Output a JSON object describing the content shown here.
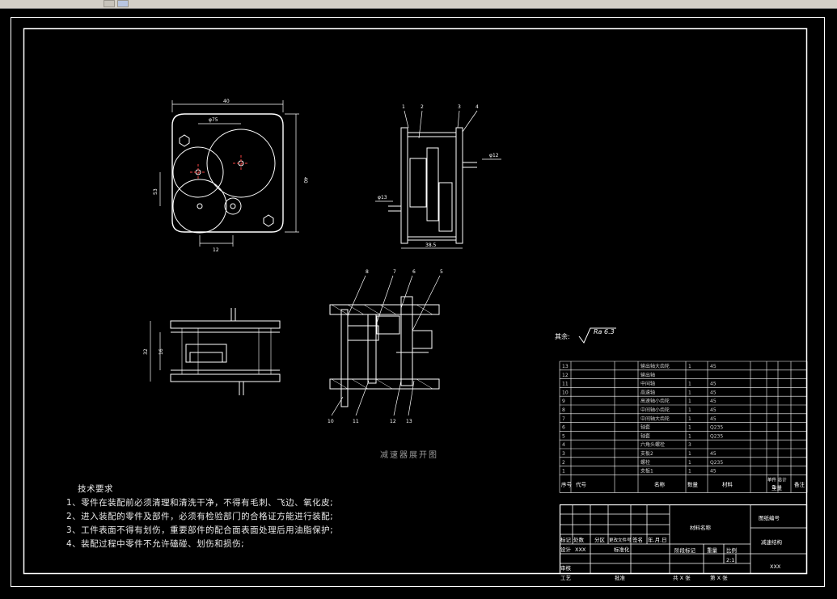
{
  "drawing": {
    "title_caption": "减速器展开图",
    "surface_finish": {
      "prefix": "其余:",
      "value": "Ra 6.3"
    },
    "dimensions": {
      "width_40": "40",
      "dia_75": "φ75",
      "height_40": "40",
      "dim_53": "53",
      "dim_12": "12",
      "dia_12_side": "φ12",
      "dia_13": "φ13",
      "dim_38_5": "38.5",
      "dim_32": "32",
      "dim_16": "16"
    },
    "balloons_side": [
      "1",
      "2",
      "3",
      "4"
    ],
    "balloons_section": [
      "5",
      "6",
      "7",
      "8"
    ],
    "balloons_bottom": [
      "10",
      "11",
      "12",
      "13"
    ]
  },
  "notes": {
    "title": "技术要求",
    "items": [
      "1、零件在装配前必须清理和清洗干净，不得有毛刺、飞边、氧化皮;",
      "2、进入装配的零件及部件，必须有检验部门的合格证方能进行装配;",
      "3、工件表面不得有划伤，重要部件的配合面表面处理后用油脂保护;",
      "4、装配过程中零件不允许磕碰、划伤和损伤;"
    ]
  },
  "parts_list": {
    "rows": [
      {
        "no": "13",
        "name": "输出轴大齿轮",
        "qty": "1",
        "mat": "45"
      },
      {
        "no": "12",
        "name": "输出轴",
        "qty": "",
        "mat": ""
      },
      {
        "no": "11",
        "name": "中间轴",
        "qty": "1",
        "mat": "45"
      },
      {
        "no": "10",
        "name": "高速轴",
        "qty": "1",
        "mat": "45"
      },
      {
        "no": "9",
        "name": "高速轴小齿轮",
        "qty": "1",
        "mat": "45"
      },
      {
        "no": "8",
        "name": "中间轴小齿轮",
        "qty": "1",
        "mat": "45"
      },
      {
        "no": "7",
        "name": "中间轴大齿轮",
        "qty": "1",
        "mat": "45"
      },
      {
        "no": "6",
        "name": "轴套",
        "qty": "1",
        "mat": "Q235"
      },
      {
        "no": "5",
        "name": "轴套",
        "qty": "1",
        "mat": "Q235"
      },
      {
        "no": "4",
        "name": "六角头螺栓",
        "qty": "3",
        "mat": ""
      },
      {
        "no": "3",
        "name": "支板2",
        "qty": "1",
        "mat": "45"
      },
      {
        "no": "2",
        "name": "螺栓",
        "qty": "1",
        "mat": "Q235"
      },
      {
        "no": "1",
        "name": "支板1",
        "qty": "1",
        "mat": "45"
      }
    ],
    "header": {
      "no": "序号",
      "code": "代号",
      "name": "名称",
      "qty": "数量",
      "mat": "材料",
      "unit_total": "单件 总计",
      "weight": "重量",
      "remark": "备注"
    }
  },
  "title_block": {
    "mark_row": [
      "标记",
      "处数",
      "分区",
      "更改文件号",
      "签名",
      "年.月.日"
    ],
    "design_label": "设计",
    "design_value": "XXX",
    "std_label": "标准化",
    "review_label": "审核",
    "process_label": "工艺",
    "approve_label": "批准",
    "material_name": "材料名称",
    "stage_label": "阶段标记",
    "weight_label": "重量",
    "scale_label": "比例",
    "scale_value": "2:1",
    "total_sheets": "共 X 张",
    "sheet_no": "第 X 张",
    "drawing_no_label": "图纸编号",
    "drawing_name": "减速结构",
    "company": "XXX"
  }
}
